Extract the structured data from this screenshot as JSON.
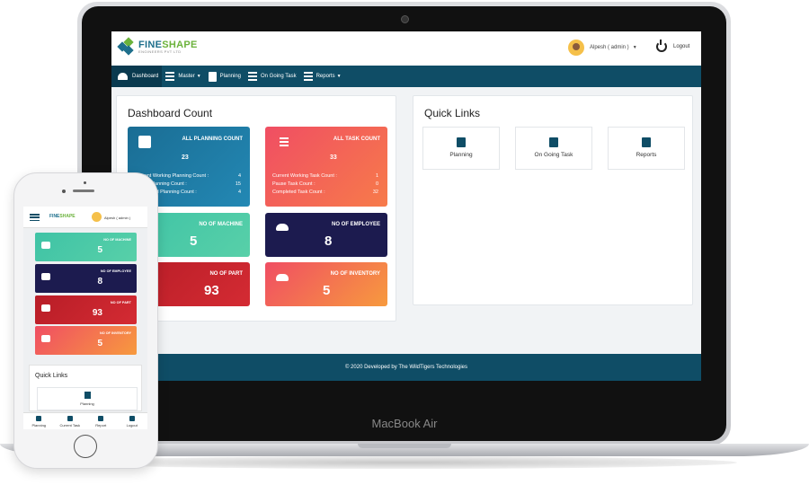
{
  "app": {
    "logo_name_main": "FINE",
    "logo_name_accent": "SHAPE",
    "logo_sub": "ENGINEERS PVT LTD",
    "user_label": "Alpesh ( admin )",
    "logout_label": "Logout"
  },
  "nav": [
    {
      "label": "Dashboard",
      "active": true
    },
    {
      "label": "Master",
      "caret": true
    },
    {
      "label": "Planning"
    },
    {
      "label": "On Going Task"
    },
    {
      "label": "Reports",
      "caret": true
    }
  ],
  "dashboard": {
    "title": "Dashboard Count",
    "planning": {
      "title": "ALL PLANNING COUNT",
      "value": "23",
      "rows": [
        {
          "label": "Current Working Planning Count :",
          "value": "4"
        },
        {
          "label": "Pause Planning Count :",
          "value": "15"
        },
        {
          "label": "Completed Planning Count :",
          "value": "4"
        }
      ]
    },
    "task": {
      "title": "ALL TASK COUNT",
      "value": "33",
      "rows": [
        {
          "label": "Current Working Task Count :",
          "value": "1"
        },
        {
          "label": "Pause Task Count :",
          "value": "0"
        },
        {
          "label": "Completed Task Count :",
          "value": "32"
        }
      ]
    },
    "machine": {
      "title": "NO OF MACHINE",
      "value": "5"
    },
    "employee": {
      "title": "NO OF EMPLOYEE",
      "value": "8"
    },
    "part": {
      "title": "NO OF PART",
      "value": "93"
    },
    "inventory": {
      "title": "NO OF INVENTORY",
      "value": "5"
    }
  },
  "quick_links": {
    "title": "Quick Links",
    "items": [
      "Planning",
      "On Going Task",
      "Reports"
    ]
  },
  "footer": "© 2020 Developed by The WildTigers Technologies",
  "laptop_label": "MacBook Air",
  "phone": {
    "user_label": "Alpesh ( admin )",
    "cards": [
      {
        "title": "NO OF MACHINE",
        "value": "5"
      },
      {
        "title": "NO OF EMPLOYEE",
        "value": "8"
      },
      {
        "title": "NO OF PART",
        "value": "93"
      },
      {
        "title": "NO OF INVENTORY",
        "value": "5"
      }
    ],
    "quick_links_title": "Quick Links",
    "quick_link": "Planning",
    "tabs": [
      "Planning",
      "Current Task",
      "Report",
      "Logout"
    ]
  },
  "colors": {
    "primary": "#0f4d66",
    "blue_card": "#1f7ea8",
    "red_gradient_start": "#f04e63",
    "orange_gradient_end": "#f79a3e",
    "teal_card": "#3ec1a5",
    "navy_card": "#1c1b4f",
    "red_card": "#c8202a"
  }
}
